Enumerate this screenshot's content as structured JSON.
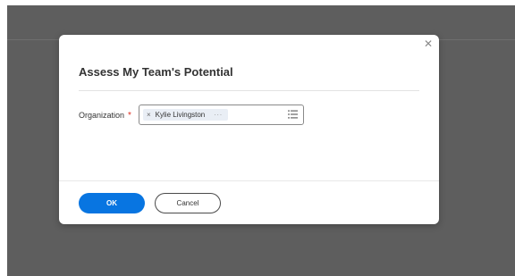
{
  "dialog": {
    "title": "Assess My Team's Potential",
    "close_icon": "close-icon"
  },
  "form": {
    "organization": {
      "label": "Organization",
      "required_marker": "*",
      "selected_value": "Kylie Livingston",
      "remove_icon": "×",
      "more_indicator": "···",
      "list_icon": "prompt-list-icon"
    }
  },
  "footer": {
    "ok_label": "OK",
    "cancel_label": "Cancel"
  },
  "colors": {
    "primary": "#0875e1",
    "required": "#de2e21",
    "backdrop": "#5e5e5e"
  }
}
